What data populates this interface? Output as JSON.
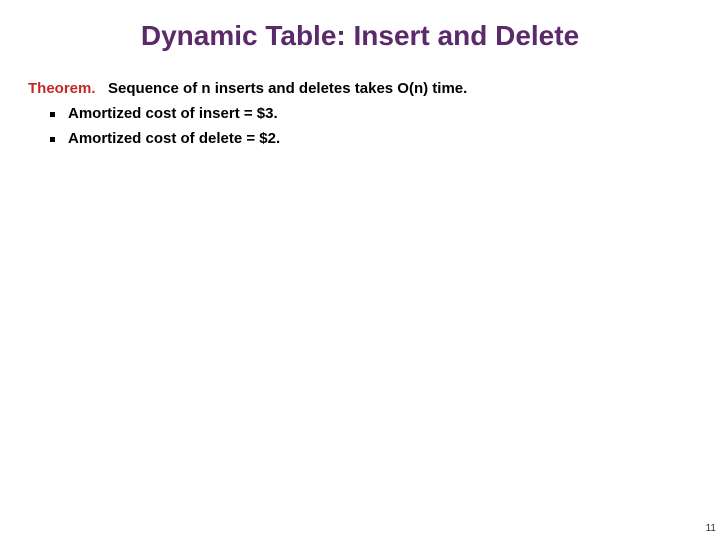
{
  "title": "Dynamic Table:  Insert and Delete",
  "theorem": {
    "label": "Theorem.",
    "text": "Sequence of n inserts and deletes takes O(n) time."
  },
  "bullets": {
    "0": "Amortized cost of insert = $3.",
    "1": "Amortized cost of delete = $2."
  },
  "page_number": "11"
}
